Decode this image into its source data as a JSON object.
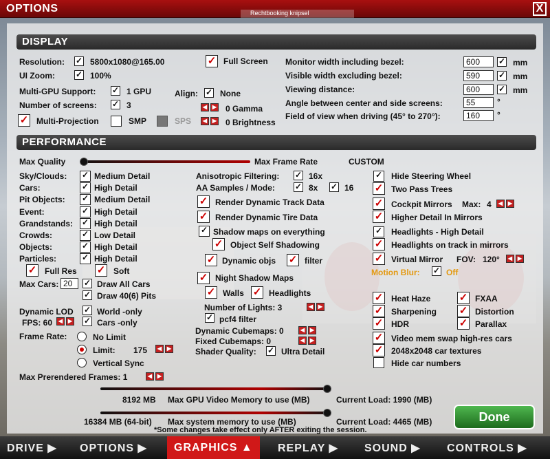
{
  "window": {
    "title": "OPTIONS",
    "close": "X",
    "ghost": "Rechtbooking knipsel"
  },
  "sections": {
    "display": "DISPLAY",
    "performance": "PERFORMANCE"
  },
  "display": {
    "resolution_label": "Resolution:",
    "resolution_value": "5800x1080@165.00",
    "fullscreen": "Full Screen",
    "uizoom_label": "UI Zoom:",
    "uizoom_value": "100%",
    "multigpu_label": "Multi-GPU Support:",
    "multigpu_value": "1 GPU",
    "align_label": "Align:",
    "align_value": "None",
    "screens_label": "Number of screens:",
    "screens_value": "3",
    "gamma": "0  Gamma",
    "brightness": "0  Brightness",
    "multiprojection": "Multi-Projection",
    "smp": "SMP",
    "sps": "SPS",
    "monitor_width_label": "Monitor width including bezel:",
    "monitor_width": "600",
    "visible_width_label": "Visible width excluding bezel:",
    "visible_width": "590",
    "viewing_label": "Viewing distance:",
    "viewing": "600",
    "angle_label": "Angle between center and side screens:",
    "angle": "55",
    "deg": "°",
    "fov_label": "Field of view when driving (45° to 270°):",
    "fov": "160",
    "mm": "mm"
  },
  "perf": {
    "maxquality": "Max Quality",
    "maxframerate": "Max Frame Rate",
    "custom": "CUSTOM",
    "rows": [
      {
        "label": "Sky/Clouds:",
        "value": "Medium Detail"
      },
      {
        "label": "Cars:",
        "value": "High Detail"
      },
      {
        "label": "Pit Objects:",
        "value": "Medium Detail"
      },
      {
        "label": "Event:",
        "value": "High Detail"
      },
      {
        "label": "Grandstands:",
        "value": "High Detail"
      },
      {
        "label": "Crowds:",
        "value": "Low Detail"
      },
      {
        "label": "Objects:",
        "value": "High Detail"
      },
      {
        "label": "Particles:",
        "value": "High Detail"
      }
    ],
    "fullres": "Full Res",
    "soft": "Soft",
    "maxcars_label": "Max Cars:",
    "maxcars": "20",
    "drawall": "Draw All Cars",
    "draw40": "Draw 40(6) Pits",
    "dynlod_label": "Dynamic LOD",
    "world_only": "World -only",
    "fps_label": "FPS: 60",
    "cars_only": "Cars -only",
    "framerate_label": "Frame Rate:",
    "nolimit": "No Limit",
    "limit": "Limit:",
    "limit_val": "175",
    "vsync": "Vertical Sync",
    "prerender": "Max Prerendered Frames: 1",
    "aniso_label": "Anisotropic Filtering:",
    "aniso": "16x",
    "aa_label": "AA Samples / Mode:",
    "aa": "8x",
    "aa2": "16",
    "rdtrack": "Render Dynamic Track Data",
    "rdtire": "Render Dynamic Tire Data",
    "shadowmaps": "Shadow maps on everything",
    "selfshadow": "Object Self Shadowing",
    "dynobjs": "Dynamic objs",
    "filter": "filter",
    "nightshadow": "Night Shadow Maps",
    "walls": "Walls",
    "headlights": "Headlights",
    "numlights": "Number of Lights: 3",
    "pcf4": "pcf4 filter",
    "dyncube": "Dynamic Cubemaps: 0",
    "fixcube": "Fixed Cubemaps: 0",
    "shader_label": "Shader Quality:",
    "shader": "Ultra Detail",
    "right": [
      "Hide Steering Wheel",
      "Two Pass Trees",
      "Cockpit Mirrors",
      "Higher Detail In Mirrors",
      "Headlights - High Detail",
      "Headlights on track in mirrors",
      "Virtual Mirror"
    ],
    "mirrors_max": "Max:",
    "mirrors_val": "4",
    "fov_label": "FOV:",
    "fov_val": "120°",
    "motionblur": "Motion Blur:",
    "off": "Off",
    "pp_left": [
      "Heat Haze",
      "Sharpening",
      "HDR"
    ],
    "pp_right": [
      "FXAA",
      "Distortion",
      "Parallax"
    ],
    "vmswap": "Video mem swap high-res cars",
    "tex2048": "2048x2048 car textures",
    "hidenums": "Hide car numbers"
  },
  "memory": {
    "gpu_val": "8192 MB",
    "gpu_label": "Max GPU Video Memory to use (MB)",
    "gpu_load": "Current Load: 1990 (MB)",
    "sys_val": "16384 MB (64-bit)",
    "sys_label": "Max system memory to use (MB)",
    "sys_load": "Current Load: 4465 (MB)",
    "note": "*Some changes take effect only AFTER exiting the session."
  },
  "done": "Done",
  "nav": {
    "drive": "DRIVE ▶",
    "options": "OPTIONS ▶",
    "graphics": "GRAPHICS ▲",
    "replay": "REPLAY ▶",
    "sound": "SOUND ▶",
    "controls": "CONTROLS ▶"
  }
}
